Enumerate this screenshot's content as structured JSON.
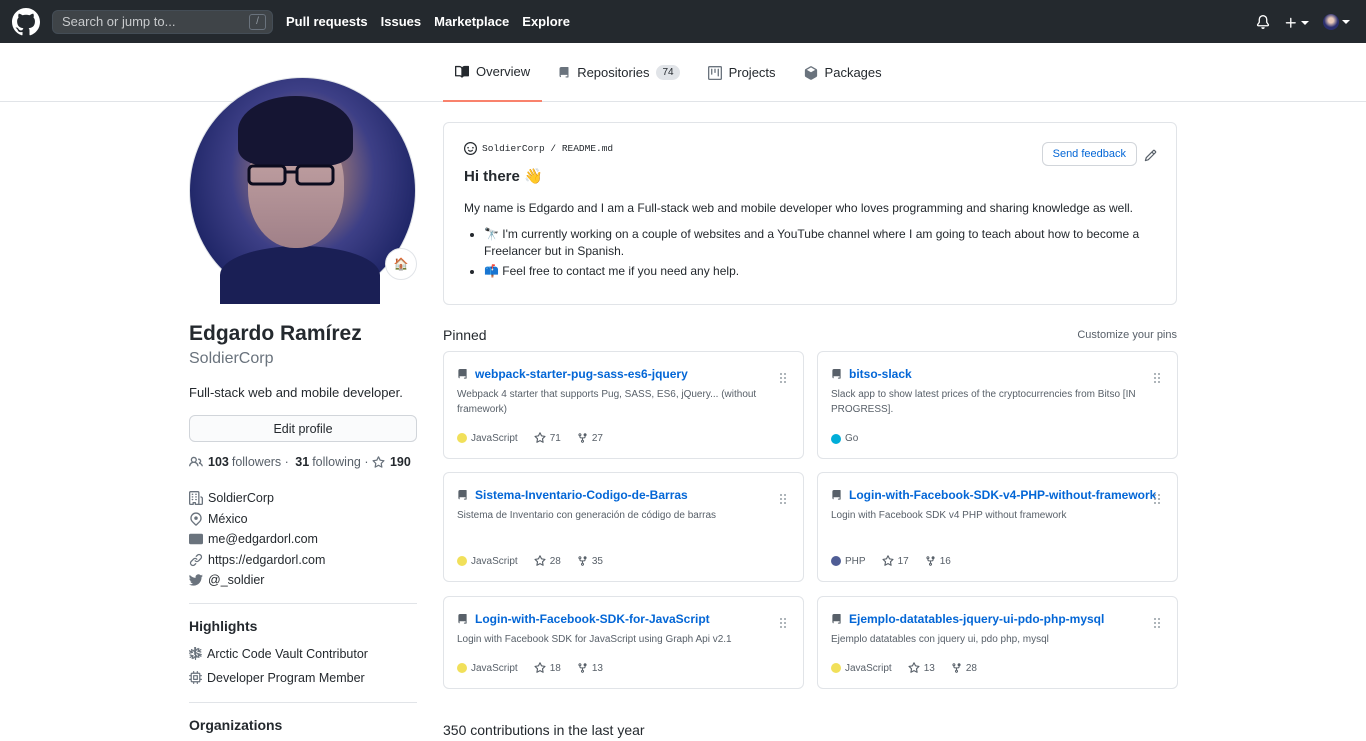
{
  "header": {
    "search_placeholder": "Search or jump to...",
    "search_shortcut": "/",
    "nav": [
      "Pull requests",
      "Issues",
      "Marketplace",
      "Explore"
    ]
  },
  "tabs": {
    "overview": "Overview",
    "repositories": "Repositories",
    "repositories_count": "74",
    "projects": "Projects",
    "packages": "Packages"
  },
  "profile": {
    "status_emoji": "🏠",
    "name": "Edgardo Ramírez",
    "login": "SoldierCorp",
    "bio": "Full-stack web and mobile developer.",
    "edit_profile": "Edit profile",
    "followers_count": "103",
    "followers_label": "followers",
    "following_count": "31",
    "following_label": "following",
    "stars_count": "190",
    "company": "SoldierCorp",
    "location": "México",
    "email": "me@edgardorl.com",
    "website": "https://edgardorl.com",
    "twitter": "@_soldier",
    "highlights_title": "Highlights",
    "highlights": [
      "Arctic Code Vault Contributor",
      "Developer Program Member"
    ],
    "organizations_title": "Organizations"
  },
  "readme": {
    "owner": "SoldierCorp",
    "separator": "/",
    "file": "README.md",
    "feedback": "Send feedback",
    "heading": "Hi there 👋",
    "intro": "My name is Edgardo and I am a Full-stack web and mobile developer who loves programming and sharing knowledge as well.",
    "bullets": [
      "🔭 I'm currently working on a couple of websites and a YouTube channel where I am going to teach about how to become a Freelancer but in Spanish.",
      "📫 Feel free to contact me if you need any help."
    ]
  },
  "pinned": {
    "title": "Pinned",
    "customize": "Customize your pins",
    "repos": [
      {
        "name": "webpack-starter-pug-sass-es6-jquery",
        "desc": "Webpack 4 starter that supports Pug, SASS, ES6, jQuery... (without framework)",
        "lang": "JavaScript",
        "lang_color": "#f1e05a",
        "stars": "71",
        "forks": "27"
      },
      {
        "name": "bitso-slack",
        "desc": "Slack app to show latest prices of the cryptocurrencies from Bitso [IN PROGRESS].",
        "lang": "Go",
        "lang_color": "#00ADD8",
        "stars": "",
        "forks": ""
      },
      {
        "name": "Sistema-Inventario-Codigo-de-Barras",
        "desc": "Sistema de Inventario con generación de código de barras",
        "lang": "JavaScript",
        "lang_color": "#f1e05a",
        "stars": "28",
        "forks": "35"
      },
      {
        "name": "Login-with-Facebook-SDK-v4-PHP-without-framework",
        "desc": "Login with Facebook SDK v4 PHP without framework",
        "lang": "PHP",
        "lang_color": "#4F5D95",
        "stars": "17",
        "forks": "16"
      },
      {
        "name": "Login-with-Facebook-SDK-for-JavaScript",
        "desc": "Login with Facebook SDK for JavaScript using Graph Api v2.1",
        "lang": "JavaScript",
        "lang_color": "#f1e05a",
        "stars": "18",
        "forks": "13"
      },
      {
        "name": "Ejemplo-datatables-jquery-ui-pdo-php-mysql",
        "desc": "Ejemplo datatables con jquery ui, pdo php, mysql",
        "lang": "JavaScript",
        "lang_color": "#f1e05a",
        "stars": "13",
        "forks": "28"
      }
    ]
  },
  "contributions": "350 contributions in the last year"
}
